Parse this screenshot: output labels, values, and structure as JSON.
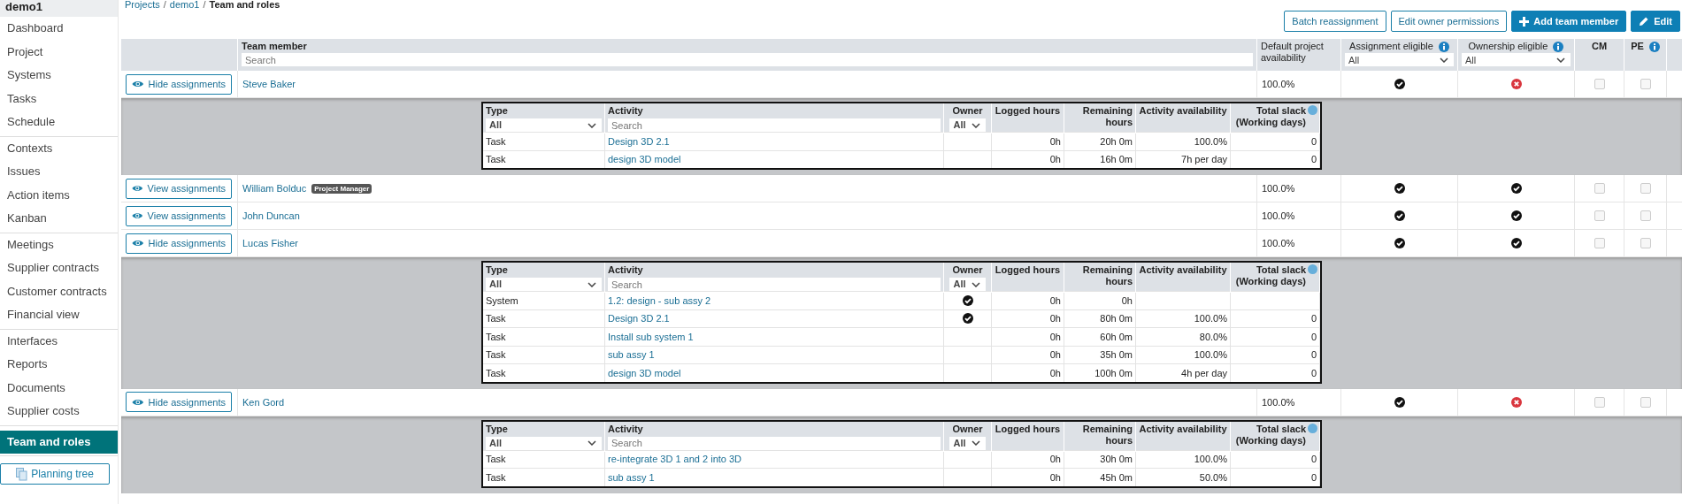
{
  "breadcrumb": {
    "separator": "/",
    "items": [
      {
        "label": "Projects",
        "link": true
      },
      {
        "label": "demo1",
        "link": true
      },
      {
        "label": "Team and roles",
        "link": false
      }
    ]
  },
  "sidebar": {
    "project": "demo1",
    "groups": [
      {
        "items": [
          {
            "label": "Dashboard",
            "selected": false
          },
          {
            "label": "Project",
            "selected": false
          },
          {
            "label": "Systems",
            "selected": false
          },
          {
            "label": "Tasks",
            "selected": false
          },
          {
            "label": "Schedule",
            "selected": false
          }
        ]
      },
      {
        "items": [
          {
            "label": "Contexts",
            "selected": false
          },
          {
            "label": "Issues",
            "selected": false
          },
          {
            "label": "Action items",
            "selected": false
          },
          {
            "label": "Kanban",
            "selected": false
          }
        ]
      },
      {
        "items": [
          {
            "label": "Meetings",
            "selected": false
          },
          {
            "label": "Supplier contracts",
            "selected": false
          },
          {
            "label": "Customer contracts",
            "selected": false
          },
          {
            "label": "Financial view",
            "selected": false
          }
        ]
      },
      {
        "items": [
          {
            "label": "Interfaces",
            "selected": false
          },
          {
            "label": "Reports",
            "selected": false
          },
          {
            "label": "Documents",
            "selected": false
          },
          {
            "label": "Supplier costs",
            "selected": false
          }
        ]
      },
      {
        "items": [
          {
            "label": "Team and roles",
            "selected": true
          }
        ]
      }
    ],
    "planning_button": "Planning tree"
  },
  "toolbar": [
    {
      "label": "Batch reassignment",
      "kind": "outline"
    },
    {
      "label": "Edit owner permissions",
      "kind": "outline"
    },
    {
      "label": "Add team member",
      "kind": "add"
    },
    {
      "label": "Edit",
      "kind": "edit"
    }
  ],
  "table": {
    "columns": [
      {
        "label": "Team member",
        "kind": "search",
        "placeholder": "Search"
      },
      {
        "label": "Default project availability",
        "kind": "plain"
      },
      {
        "label": "Assignment eligible",
        "info": true,
        "kind": "select",
        "value": "All"
      },
      {
        "label": "Ownership eligible",
        "info": true,
        "kind": "select",
        "value": "All"
      },
      {
        "label": "CM",
        "kind": "plain"
      },
      {
        "label": "PE",
        "info": true,
        "kind": "plain"
      }
    ],
    "members": [
      {
        "toggle": "Hide assignments",
        "expanded": true,
        "name": "Steve Baker",
        "availability": "100.0%",
        "assignment_eligible": true,
        "ownership_eligible": false,
        "cm": false,
        "pe": false,
        "assignments": {
          "columns": [
            "Type",
            "Activity",
            "Owner",
            "Logged hours",
            "Remaining hours",
            "Activity availability",
            "Total slack (Working days)"
          ],
          "type_filter": "All",
          "activity_placeholder": "Search",
          "owner_filter": "All",
          "rows": [
            {
              "type": "Task",
              "activity": "Design 3D 2.1",
              "owner": false,
              "logged": "0h",
              "remaining": "20h 0m",
              "availability": "100.0%",
              "slack": "0"
            },
            {
              "type": "Task",
              "activity": "design 3D model",
              "owner": false,
              "logged": "0h",
              "remaining": "16h 0m",
              "availability": "7h per day",
              "slack": "0"
            }
          ]
        }
      },
      {
        "toggle": "View assignments",
        "expanded": false,
        "name": "William Bolduc",
        "badge": "Project Manager",
        "availability": "100.0%",
        "assignment_eligible": true,
        "ownership_eligible": true,
        "cm": false,
        "pe": false
      },
      {
        "toggle": "View assignments",
        "expanded": false,
        "name": "John Duncan",
        "availability": "100.0%",
        "assignment_eligible": true,
        "ownership_eligible": true,
        "cm": false,
        "pe": false
      },
      {
        "toggle": "Hide assignments",
        "expanded": true,
        "name": "Lucas Fisher",
        "availability": "100.0%",
        "assignment_eligible": true,
        "ownership_eligible": true,
        "cm": false,
        "pe": false,
        "assignments": {
          "columns": [
            "Type",
            "Activity",
            "Owner",
            "Logged hours",
            "Remaining hours",
            "Activity availability",
            "Total slack (Working days)"
          ],
          "type_filter": "All",
          "activity_placeholder": "Search",
          "owner_filter": "All",
          "rows": [
            {
              "type": "System",
              "activity": "1.2: design - sub assy 2",
              "owner": true,
              "logged": "0h",
              "remaining": "0h"
            },
            {
              "type": "Task",
              "activity": "Design 3D 2.1",
              "owner": true,
              "logged": "0h",
              "remaining": "80h 0m",
              "availability": "100.0%",
              "slack": "0"
            },
            {
              "type": "Task",
              "activity": "Install sub system 1",
              "owner": false,
              "logged": "0h",
              "remaining": "60h 0m",
              "availability": "80.0%",
              "slack": "0"
            },
            {
              "type": "Task",
              "activity": "sub assy 1",
              "owner": false,
              "logged": "0h",
              "remaining": "35h 0m",
              "availability": "100.0%",
              "slack": "0"
            },
            {
              "type": "Task",
              "activity": "design 3D model",
              "owner": false,
              "logged": "0h",
              "remaining": "100h 0m",
              "availability": "4h per day",
              "slack": "0"
            }
          ]
        }
      },
      {
        "toggle": "Hide assignments",
        "expanded": true,
        "name": "Ken Gord",
        "availability": "100.0%",
        "assignment_eligible": true,
        "ownership_eligible": false,
        "cm": false,
        "pe": false,
        "assignments": {
          "columns": [
            "Type",
            "Activity",
            "Owner",
            "Logged hours",
            "Remaining hours",
            "Activity availability",
            "Total slack (Working days)"
          ],
          "type_filter": "All",
          "activity_placeholder": "Search",
          "owner_filter": "All",
          "rows": [
            {
              "type": "Task",
              "activity": "re-integrate 3D 1 and 2 into 3D",
              "owner": false,
              "logged": "0h",
              "remaining": "30h 0m",
              "availability": "100.0%",
              "slack": "0"
            },
            {
              "type": "Task",
              "activity": "sub assy 1",
              "owner": false,
              "logged": "0h",
              "remaining": "45h 0m",
              "availability": "50.0%",
              "slack": "0"
            }
          ]
        }
      }
    ]
  }
}
